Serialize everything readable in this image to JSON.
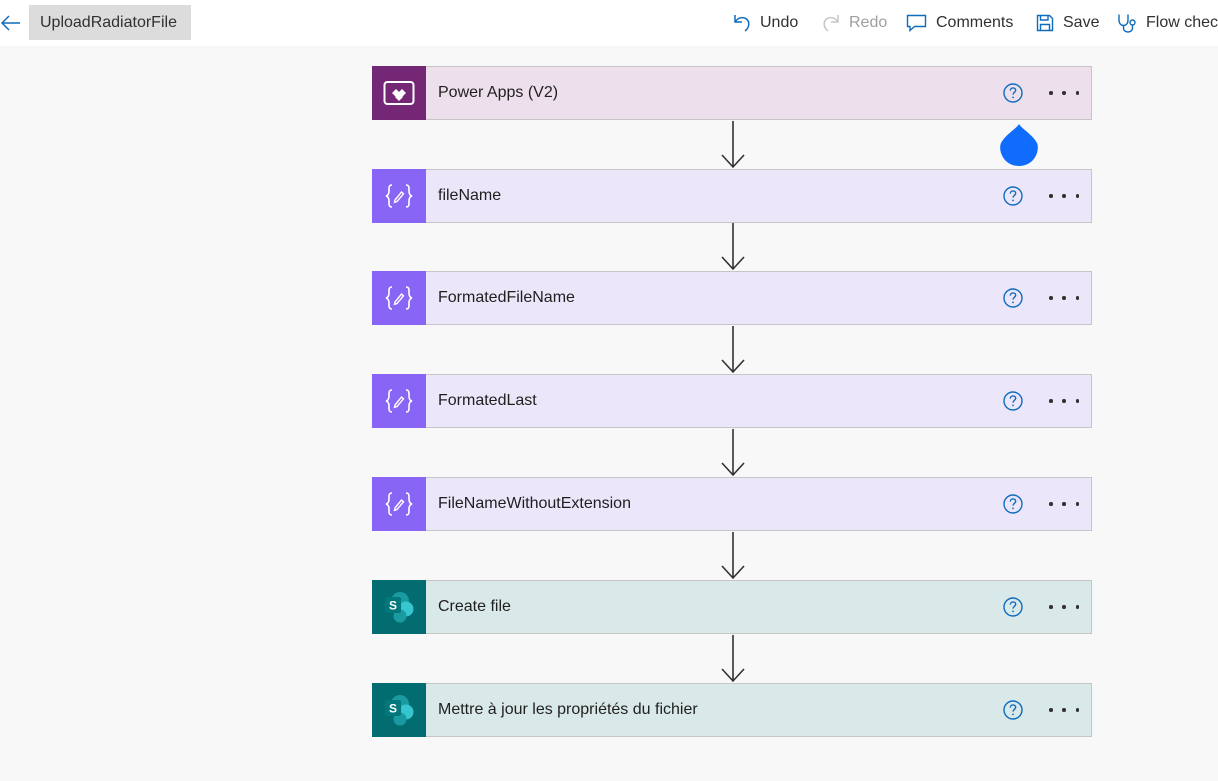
{
  "header": {
    "flow_name": "UploadRadiatorFile",
    "undo_label": "Undo",
    "redo_label": "Redo",
    "comments_label": "Comments",
    "save_label": "Save",
    "flow_checker_label": "Flow checker"
  },
  "colors": {
    "accent": "#0f6cbd",
    "powerapps_bg": "#ede0ec",
    "powerapps_icon": "#742774",
    "variable_bg": "#ece6fb",
    "variable_icon": "#8865f5",
    "sharepoint_bg": "#d9e8e8",
    "sharepoint_icon": "#036c70",
    "drop_handle": "#0f6cfd"
  },
  "steps": [
    {
      "title": "Power Apps (V2)",
      "icon": "powerapps-icon"
    },
    {
      "title": "fileName",
      "icon": "variable-icon"
    },
    {
      "title": "FormatedFileName",
      "icon": "variable-icon"
    },
    {
      "title": "FormatedLast",
      "icon": "variable-icon"
    },
    {
      "title": "FileNameWithoutExtension",
      "icon": "variable-icon"
    },
    {
      "title": "Create file",
      "icon": "sharepoint-icon"
    },
    {
      "title": "Mettre à jour les propriétés du fichier",
      "icon": "sharepoint-icon"
    }
  ]
}
